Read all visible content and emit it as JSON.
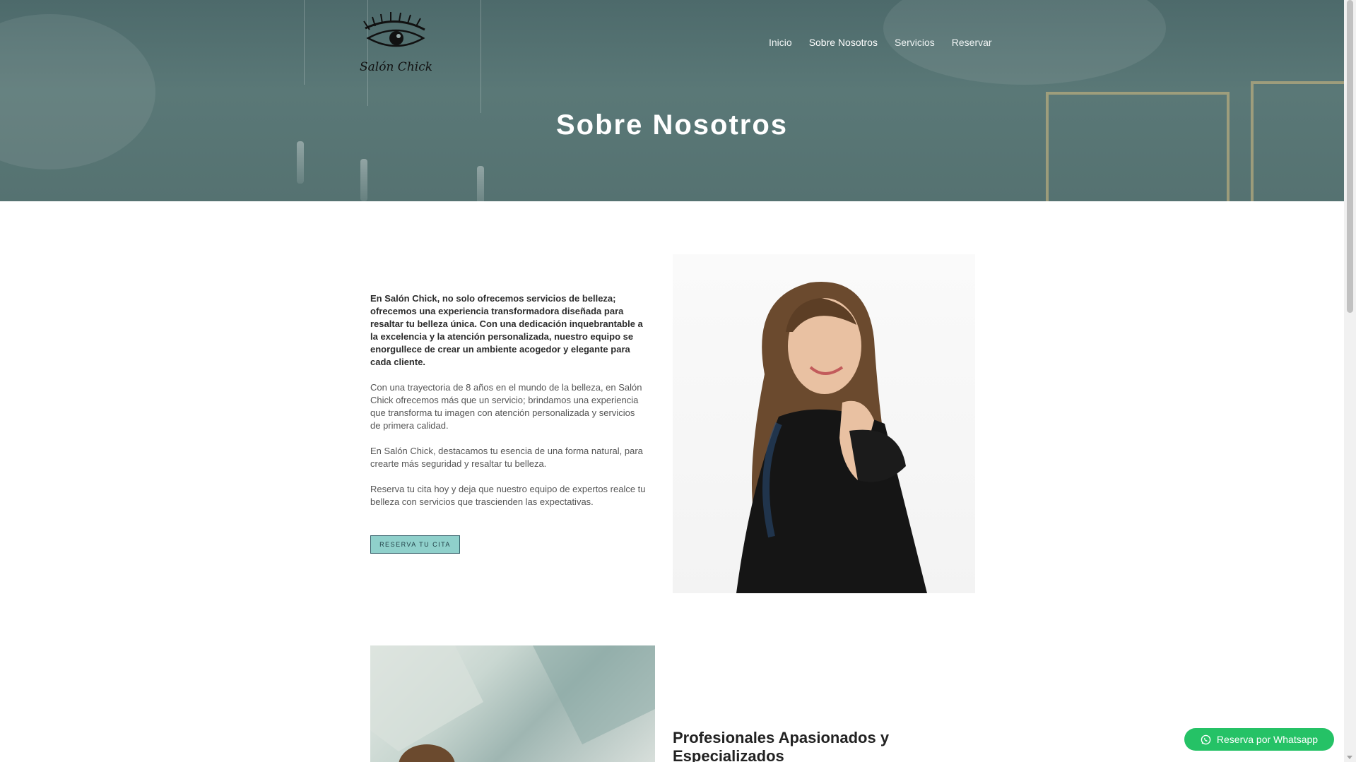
{
  "brand": {
    "logo_text": "Salón Chick",
    "logo_icon": "eye-lashes-icon"
  },
  "nav": {
    "items": [
      {
        "label": "Inicio"
      },
      {
        "label": "Sobre Nosotros",
        "active": true
      },
      {
        "label": "Servicios"
      },
      {
        "label": "Reservar"
      }
    ]
  },
  "hero": {
    "title": "Sobre Nosotros"
  },
  "about": {
    "lead": "En Salón Chick, no solo ofrecemos servicios de belleza; ofrecemos una experiencia transformadora diseñada para resaltar tu belleza única. Con una dedicación inquebrantable a la excelencia y la atención personalizada, nuestro equipo se enorgullece de crear un ambiente acogedor y elegante para cada cliente.",
    "paragraph_1": "Con una trayectoria de 8 años en el mundo de la belleza, en Salón Chick ofrecemos más que un servicio; brindamos una experiencia que transforma tu imagen con atención personalizada y servicios de primera calidad.",
    "paragraph_2": "En Salón Chick, destacamos tu esencia de una forma natural, para crearte más seguridad y resaltar tu belleza.",
    "paragraph_3": "Reserva tu cita hoy y deja que nuestro equipo de expertos realce tu belleza con servicios que trascienden las expectativas.",
    "cta_label": "RESERVA TU CITA"
  },
  "second": {
    "heading": "Profesionales Apasionados y Especializados"
  },
  "whatsapp": {
    "label": "Reserva por Whatsapp",
    "icon": "whatsapp-icon",
    "color": "#25c266"
  },
  "colors": {
    "hero_overlay": "#557271",
    "cta_bg": "#8fd0cb",
    "cta_border": "#35606a"
  }
}
